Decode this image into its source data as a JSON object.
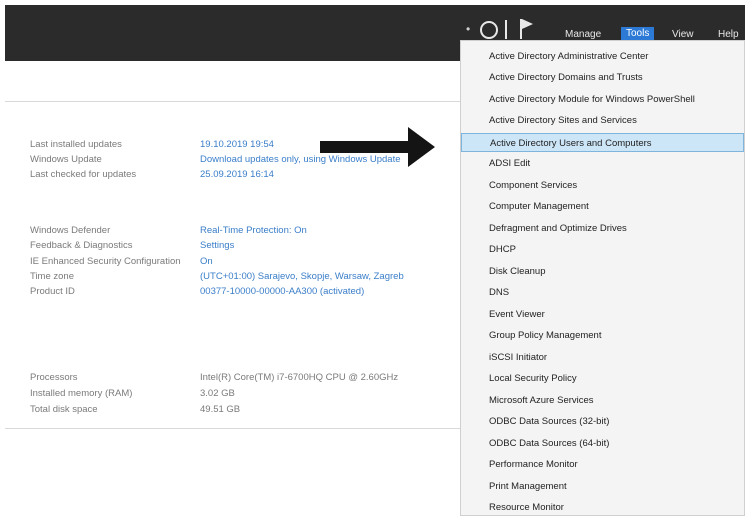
{
  "toolbar": {
    "menus": [
      "Manage",
      "Tools",
      "View",
      "Help"
    ],
    "active_menu": "Tools"
  },
  "properties": {
    "update_group": [
      {
        "label": "Last installed updates",
        "value": "19.10.2019 19:54"
      },
      {
        "label": "Windows Update",
        "value": "Download updates only, using Windows Update"
      },
      {
        "label": "Last checked for updates",
        "value": "25.09.2019 16:14"
      }
    ],
    "settings_group": [
      {
        "label": "Windows Defender",
        "value": "Real-Time Protection: On"
      },
      {
        "label": "Feedback & Diagnostics",
        "value": "Settings"
      },
      {
        "label": "IE Enhanced Security Configuration",
        "value": "On"
      },
      {
        "label": "Time zone",
        "value": "(UTC+01:00) Sarajevo, Skopje, Warsaw, Zagreb"
      },
      {
        "label": "Product ID",
        "value": "00377-10000-00000-AA300 (activated)"
      }
    ],
    "hardware_group": [
      {
        "label": "Processors",
        "value": "Intel(R) Core(TM) i7-6700HQ CPU @ 2.60GHz"
      },
      {
        "label": "Installed memory (RAM)",
        "value": "3.02 GB"
      },
      {
        "label": "Total disk space",
        "value": "49.51 GB"
      }
    ]
  },
  "tools_menu": {
    "items": [
      "Active Directory Administrative Center",
      "Active Directory Domains and Trusts",
      "Active Directory Module for Windows PowerShell",
      "Active Directory Sites and Services",
      "Active Directory Users and Computers",
      "ADSI Edit",
      "Component Services",
      "Computer Management",
      "Defragment and Optimize Drives",
      "DHCP",
      "Disk Cleanup",
      "DNS",
      "Event Viewer",
      "Group Policy Management",
      "iSCSI Initiator",
      "Local Security Policy",
      "Microsoft Azure Services",
      "ODBC Data Sources (32-bit)",
      "ODBC Data Sources (64-bit)",
      "Performance Monitor",
      "Print Management",
      "Resource Monitor"
    ],
    "highlighted": "Active Directory Users and Computers"
  }
}
